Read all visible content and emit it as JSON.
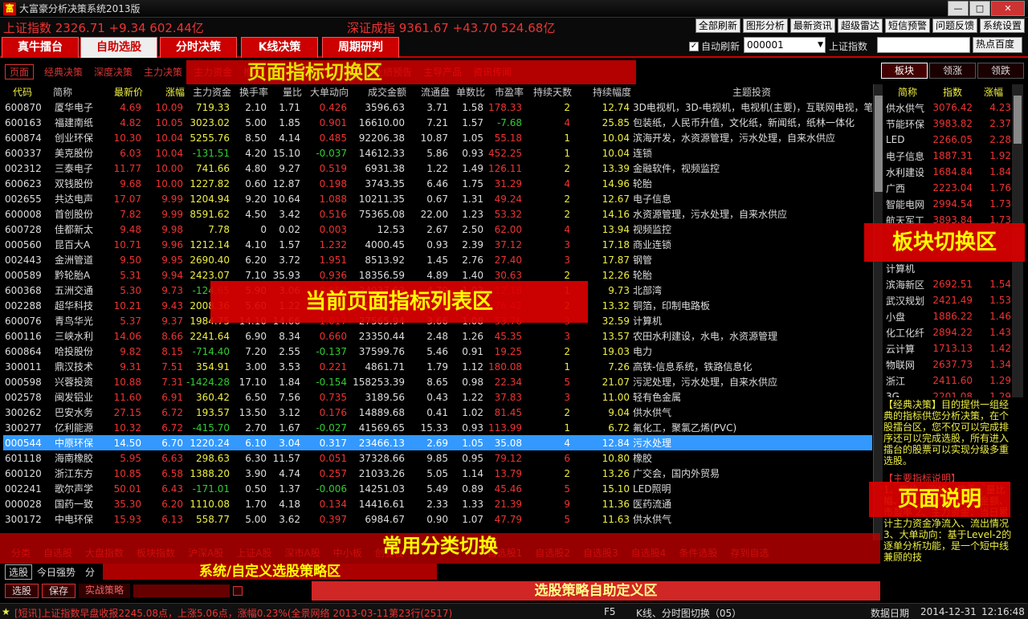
{
  "window": {
    "title": "大富豪分析决策系统2013版",
    "logo": "富",
    "min": "—",
    "max": "□",
    "close": "✕"
  },
  "indices": {
    "sh": "上证指数  2326.71  +9.34  602.44亿",
    "sz": "深证成指  9361.67  +43.70  524.68亿"
  },
  "toolbar": [
    "全部刷新",
    "图形分析",
    "最新资讯",
    "超级雷达",
    "短信预警",
    "问题反馈",
    "系统设置"
  ],
  "main_tabs": [
    "真牛擂台",
    "自助选股",
    "分时决策",
    "K线决策",
    "周期研判"
  ],
  "active_main_tab": 1,
  "auto_refresh_label": "自动刷新",
  "stock_code": "000001",
  "index_label": "上证指数",
  "hot_button": "热点百度",
  "sub_tabs": [
    "页面",
    "经典决策",
    "深度决策",
    "主力决策",
    "主力资金",
    "推荐",
    "流行指标",
    "业绩预测",
    "业绩预告",
    "主导产品",
    "资讯传闻"
  ],
  "side_tabs": [
    "板块",
    "领涨",
    "领跌"
  ],
  "columns": [
    "代码",
    "简称",
    "最新价",
    "涨幅",
    "主力资金",
    "换手率",
    "量比",
    "大单动向",
    "成交金额",
    "流通盘",
    "单数比",
    "市盈率",
    "持续天数",
    "持续幅度",
    "主题投资"
  ],
  "rows": [
    {
      "code": "600870",
      "name": "厦华电子",
      "price": "4.69",
      "chg": "10.09",
      "fund": "719.33",
      "turn": "2.10",
      "vr": "1.71",
      "big": "0.426",
      "amt": "3596.63",
      "float": "3.71",
      "ratio": "1.58",
      "pe": "178.33",
      "days": "2",
      "range": "12.74",
      "topic": "3D电视机，3D-电视机，电视机(主要)，互联网电视，笔"
    },
    {
      "code": "600163",
      "name": "福建南纸",
      "price": "4.82",
      "chg": "10.05",
      "fund": "3023.02",
      "turn": "5.00",
      "vr": "1.85",
      "big": "0.901",
      "amt": "16610.00",
      "float": "7.21",
      "ratio": "1.57",
      "pe": "-7.68",
      "days": "4",
      "range": "25.85",
      "topic": "包装纸，人民币升值，文化纸，新闻纸，纸林一体化"
    },
    {
      "code": "600874",
      "name": "创业环保",
      "price": "10.30",
      "chg": "10.04",
      "fund": "5255.76",
      "turn": "8.50",
      "vr": "4.14",
      "big": "0.485",
      "amt": "92206.38",
      "float": "10.87",
      "ratio": "1.05",
      "pe": "55.18",
      "days": "1",
      "range": "10.04",
      "topic": "滨海开发，水资源管理，污水处理，自来水供应"
    },
    {
      "code": "600337",
      "name": "美克股份",
      "price": "6.03",
      "chg": "10.04",
      "fund": "-131.51",
      "turn": "4.20",
      "vr": "15.10",
      "big": "-0.037",
      "amt": "14612.33",
      "float": "5.86",
      "ratio": "0.93",
      "pe": "452.25",
      "days": "1",
      "range": "10.04",
      "topic": "连锁"
    },
    {
      "code": "002312",
      "name": "三泰电子",
      "price": "11.77",
      "chg": "10.00",
      "fund": "741.66",
      "turn": "4.80",
      "vr": "9.27",
      "big": "0.519",
      "amt": "6931.38",
      "float": "1.22",
      "ratio": "1.49",
      "pe": "126.11",
      "days": "2",
      "range": "13.39",
      "topic": "金融软件，视频监控"
    },
    {
      "code": "600623",
      "name": "双钱股份",
      "price": "9.68",
      "chg": "10.00",
      "fund": "1227.82",
      "turn": "0.60",
      "vr": "12.87",
      "big": "0.198",
      "amt": "3743.35",
      "float": "6.46",
      "ratio": "1.75",
      "pe": "31.29",
      "days": "4",
      "range": "14.96",
      "topic": "轮胎"
    },
    {
      "code": "002655",
      "name": "共达电声",
      "price": "17.07",
      "chg": "9.99",
      "fund": "1204.94",
      "turn": "9.20",
      "vr": "10.64",
      "big": "1.088",
      "amt": "10211.35",
      "float": "0.67",
      "ratio": "1.31",
      "pe": "49.24",
      "days": "2",
      "range": "12.67",
      "topic": "电子信息"
    },
    {
      "code": "600008",
      "name": "首创股份",
      "price": "7.82",
      "chg": "9.99",
      "fund": "8591.62",
      "turn": "4.50",
      "vr": "3.42",
      "big": "0.516",
      "amt": "75365.08",
      "float": "22.00",
      "ratio": "1.23",
      "pe": "53.32",
      "days": "2",
      "range": "14.16",
      "topic": "水资源管理，污水处理，自来水供应"
    },
    {
      "code": "600728",
      "name": "佳都新太",
      "price": "9.48",
      "chg": "9.98",
      "fund": "7.78",
      "turn": "0",
      "vr": "0.02",
      "big": "0.003",
      "amt": "12.53",
      "float": "2.67",
      "ratio": "2.50",
      "pe": "62.00",
      "days": "4",
      "range": "13.94",
      "topic": "视频监控"
    },
    {
      "code": "000560",
      "name": "昆百大A",
      "price": "10.71",
      "chg": "9.96",
      "fund": "1212.14",
      "turn": "4.10",
      "vr": "1.57",
      "big": "1.232",
      "amt": "4000.45",
      "float": "0.93",
      "ratio": "2.39",
      "pe": "37.12",
      "days": "3",
      "range": "17.18",
      "topic": "商业连锁"
    },
    {
      "code": "002443",
      "name": "金洲管道",
      "price": "9.50",
      "chg": "9.95",
      "fund": "2690.40",
      "turn": "6.20",
      "vr": "3.72",
      "big": "1.951",
      "amt": "8513.92",
      "float": "1.45",
      "ratio": "2.76",
      "pe": "27.40",
      "days": "3",
      "range": "17.87",
      "topic": "钢管"
    },
    {
      "code": "000589",
      "name": "黔轮胎A",
      "price": "5.31",
      "chg": "9.94",
      "fund": "2423.07",
      "turn": "7.10",
      "vr": "35.93",
      "big": "0.936",
      "amt": "18356.59",
      "float": "4.89",
      "ratio": "1.40",
      "pe": "30.63",
      "days": "2",
      "range": "12.26",
      "topic": "轮胎"
    },
    {
      "code": "600368",
      "name": "五洲交通",
      "price": "5.30",
      "chg": "9.73",
      "fund": "-124.65",
      "turn": "5.90",
      "vr": "3.06",
      "big": "-0.050",
      "amt": "24937.63",
      "float": "4.79",
      "ratio": "1.03",
      "pe": "12.18",
      "days": "1",
      "range": "9.73",
      "topic": "北部湾"
    },
    {
      "code": "002288",
      "name": "超华科技",
      "price": "10.21",
      "chg": "9.43",
      "fund": "2008.36",
      "turn": "5.60",
      "vr": "1.22",
      "big": "1.054",
      "amt": "19043.00",
      "float": "1.86",
      "ratio": "1.38",
      "pe": "76.42",
      "days": "2",
      "range": "13.32",
      "topic": "铜箔，印制电路板"
    },
    {
      "code": "600076",
      "name": "青鸟华光",
      "price": "5.37",
      "chg": "9.37",
      "fund": "1984.75",
      "turn": "14.10",
      "vr": "14.66",
      "big": "1.017",
      "amt": "27565.94",
      "float": "3.66",
      "ratio": "1.08",
      "pe": "53.76",
      "days": "3",
      "range": "32.59",
      "topic": "计算机"
    },
    {
      "code": "600116",
      "name": "三峡水利",
      "price": "14.06",
      "chg": "8.66",
      "fund": "2241.64",
      "turn": "6.90",
      "vr": "8.34",
      "big": "0.660",
      "amt": "23350.44",
      "float": "2.48",
      "ratio": "1.26",
      "pe": "45.35",
      "days": "3",
      "range": "13.57",
      "topic": "农田水利建设，水电，水资源管理"
    },
    {
      "code": "600864",
      "name": "哈投股份",
      "price": "9.82",
      "chg": "8.15",
      "fund": "-714.40",
      "turn": "7.20",
      "vr": "2.55",
      "big": "-0.137",
      "amt": "37599.76",
      "float": "5.46",
      "ratio": "0.91",
      "pe": "19.25",
      "days": "2",
      "range": "19.03",
      "topic": "电力"
    },
    {
      "code": "300011",
      "name": "鼎汉技术",
      "price": "9.31",
      "chg": "7.51",
      "fund": "354.91",
      "turn": "3.00",
      "vr": "3.53",
      "big": "0.221",
      "amt": "4861.71",
      "float": "1.79",
      "ratio": "1.12",
      "pe": "180.08",
      "days": "1",
      "range": "7.26",
      "topic": "高铁-信息系统，铁路信息化"
    },
    {
      "code": "000598",
      "name": "兴蓉投资",
      "price": "10.88",
      "chg": "7.31",
      "fund": "-1424.28",
      "turn": "17.10",
      "vr": "1.84",
      "big": "-0.154",
      "amt": "158253.39",
      "float": "8.65",
      "ratio": "0.98",
      "pe": "22.34",
      "days": "5",
      "range": "21.07",
      "topic": "污泥处理，污水处理，自来水供应"
    },
    {
      "code": "002578",
      "name": "闽发铝业",
      "price": "11.60",
      "chg": "6.91",
      "fund": "360.42",
      "turn": "6.50",
      "vr": "7.56",
      "big": "0.735",
      "amt": "3189.56",
      "float": "0.43",
      "ratio": "1.22",
      "pe": "37.83",
      "days": "3",
      "range": "11.00",
      "topic": "轻有色金属"
    },
    {
      "code": "300262",
      "name": "巴安水务",
      "price": "27.15",
      "chg": "6.72",
      "fund": "193.57",
      "turn": "13.50",
      "vr": "3.12",
      "big": "0.176",
      "amt": "14889.68",
      "float": "0.41",
      "ratio": "1.02",
      "pe": "81.45",
      "days": "2",
      "range": "9.04",
      "topic": "供水供气"
    },
    {
      "code": "300277",
      "name": "亿利能源",
      "price": "10.32",
      "chg": "6.72",
      "fund": "-415.70",
      "turn": "2.70",
      "vr": "1.67",
      "big": "-0.027",
      "amt": "41569.65",
      "float": "15.33",
      "ratio": "0.93",
      "pe": "113.99",
      "days": "1",
      "range": "6.72",
      "topic": "氟化工，聚氯乙烯(PVC)"
    },
    {
      "code": "000544",
      "name": "中原环保",
      "price": "14.50",
      "chg": "6.70",
      "fund": "1220.24",
      "turn": "6.10",
      "vr": "3.04",
      "big": "0.317",
      "amt": "23466.13",
      "float": "2.69",
      "ratio": "1.05",
      "pe": "35.08",
      "days": "4",
      "range": "12.84",
      "topic": "污水处理"
    },
    {
      "code": "601118",
      "name": "海南橡胶",
      "price": "5.95",
      "chg": "6.63",
      "fund": "298.63",
      "turn": "6.30",
      "vr": "11.57",
      "big": "0.051",
      "amt": "37328.66",
      "float": "9.85",
      "ratio": "0.95",
      "pe": "79.12",
      "days": "6",
      "range": "10.80",
      "topic": "橡胶"
    },
    {
      "code": "600120",
      "name": "浙江东方",
      "price": "10.85",
      "chg": "6.58",
      "fund": "1388.20",
      "turn": "3.90",
      "vr": "4.74",
      "big": "0.257",
      "amt": "21033.26",
      "float": "5.05",
      "ratio": "1.14",
      "pe": "13.79",
      "days": "2",
      "range": "13.26",
      "topic": "广交会，国内外贸易"
    },
    {
      "code": "002241",
      "name": "歌尔声学",
      "price": "50.01",
      "chg": "6.43",
      "fund": "-171.01",
      "turn": "0.50",
      "vr": "1.37",
      "big": "-0.006",
      "amt": "14251.03",
      "float": "5.49",
      "ratio": "0.89",
      "pe": "45.46",
      "days": "5",
      "range": "15.10",
      "topic": "LED照明"
    },
    {
      "code": "000028",
      "name": "国药一致",
      "price": "35.30",
      "chg": "6.20",
      "fund": "1110.08",
      "turn": "1.70",
      "vr": "4.18",
      "big": "0.134",
      "amt": "14416.61",
      "float": "2.33",
      "ratio": "1.33",
      "pe": "21.39",
      "days": "9",
      "range": "11.36",
      "topic": "医药流通"
    },
    {
      "code": "300172",
      "name": "中电环保",
      "price": "15.93",
      "chg": "6.13",
      "fund": "558.77",
      "turn": "5.00",
      "vr": "3.62",
      "big": "0.397",
      "amt": "6984.67",
      "float": "0.90",
      "ratio": "1.07",
      "pe": "47.79",
      "days": "5",
      "range": "11.63",
      "topic": "供水供气"
    }
  ],
  "selected_row": 22,
  "sector_columns": [
    "简称",
    "指数",
    "涨幅"
  ],
  "sectors": [
    {
      "name": "供水供气",
      "idx": "3076.42",
      "chg": "4.23"
    },
    {
      "name": "节能环保",
      "idx": "3983.82",
      "chg": "2.37"
    },
    {
      "name": "LED",
      "idx": "2266.05",
      "chg": "2.28"
    },
    {
      "name": "电子信息",
      "idx": "1887.31",
      "chg": "1.92"
    },
    {
      "name": "水利建设",
      "idx": "1684.84",
      "chg": "1.84"
    },
    {
      "name": "广西",
      "idx": "2223.04",
      "chg": "1.76"
    },
    {
      "name": "智能电网",
      "idx": "2994.54",
      "chg": "1.73"
    },
    {
      "name": "航天军工",
      "idx": "3893.84",
      "chg": "1.73"
    },
    {
      "name": "",
      "idx": "",
      "chg": ""
    },
    {
      "name": "",
      "idx": "",
      "chg": ""
    },
    {
      "name": "计算机",
      "idx": "",
      "chg": ""
    },
    {
      "name": "滨海新区",
      "idx": "2692.51",
      "chg": "1.54"
    },
    {
      "name": "武汉规划",
      "idx": "2421.49",
      "chg": "1.53"
    },
    {
      "name": "小盘",
      "idx": "1886.22",
      "chg": "1.46"
    },
    {
      "name": "化工化纤",
      "idx": "2894.22",
      "chg": "1.43"
    },
    {
      "name": "云计算",
      "idx": "1713.13",
      "chg": "1.42"
    },
    {
      "name": "物联网",
      "idx": "2637.73",
      "chg": "1.34"
    },
    {
      "name": "浙江",
      "idx": "2411.60",
      "chg": "1.29"
    },
    {
      "name": "3G",
      "idx": "2201.08",
      "chg": "1.29"
    }
  ],
  "description": {
    "heading": "【经典决策】目的提供一组经典的指标供您分析决策，在个股擂台区，您不仅可以完成排序还可以完成选股，所有进入擂台的股票可以实现分级多重选股。",
    "heading2": "【主要指标说明】",
    "body2": "1、现价、涨幅、换手、量比幅、主力、总股本、总金额、市盈率 2、主力资金：当日累计主力资金净流入、流出情况 3、大单动向：基于Level-2的逐单分析功能，是一个短中线兼顾的技"
  },
  "categories": [
    "分类",
    "自选股",
    "大盘指数",
    "板块指数",
    "沪深A股",
    "上证A股",
    "深市A股",
    "中小板",
    "创业板",
    "",
    "",
    "自选股1",
    "自选股2",
    "自选股3",
    "自选股4",
    "条件选股",
    "存到自选"
  ],
  "strategies": [
    "选股",
    "今日强势",
    "分"
  ],
  "actions": {
    "select": "选股",
    "save": "保存",
    "custom_label": "实战策略"
  },
  "status": {
    "news": "[短讯]上证指数早盘收报2245.08点，上涨5.06点，涨幅0.23%(全景网络 2013-03-11第23行(2517)",
    "f5": "F5",
    "switch": "K线、分时图切换（05）",
    "date_label": "数据日期",
    "date": "2014-12-31",
    "time": "12:16:48"
  },
  "annotations": {
    "indicator_switch": "页面指标切换区",
    "sector_switch": "板块切换区",
    "list_area": "当前页面指标列表区",
    "page_desc": "页面说明",
    "category_switch": "常用分类切换",
    "strategy_area": "系统/自定义选股策略区",
    "custom_area": "选股策略自助定义区"
  },
  "colors": {
    "up": "#e33",
    "down": "#3c3",
    "accent": "#cc0000",
    "selection": "#3399ff"
  }
}
